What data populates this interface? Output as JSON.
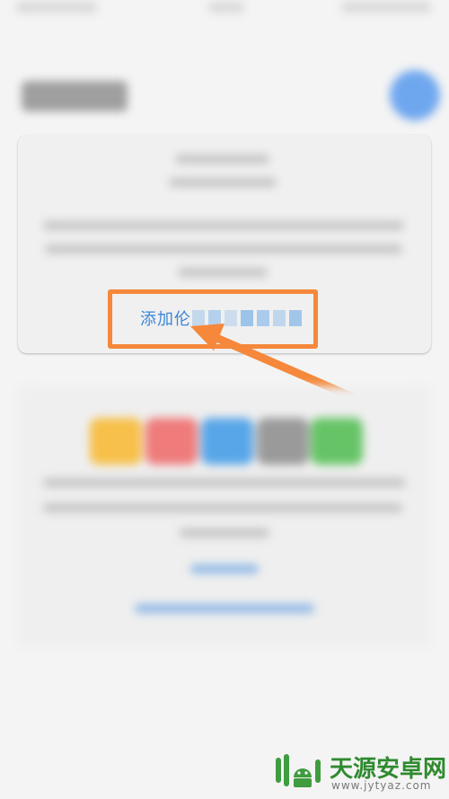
{
  "card": {
    "action_text": "添加伦"
  },
  "colors": {
    "annotation": "#f5883a",
    "link_blue": "#3a86d9",
    "watermark_green": "#2f8a2f"
  },
  "icons": {
    "profile": "profile-icon",
    "watermark": "phone-android-logo-icon"
  },
  "watermark": {
    "title": "天源安卓网",
    "url": "www.jytyaz.com"
  }
}
